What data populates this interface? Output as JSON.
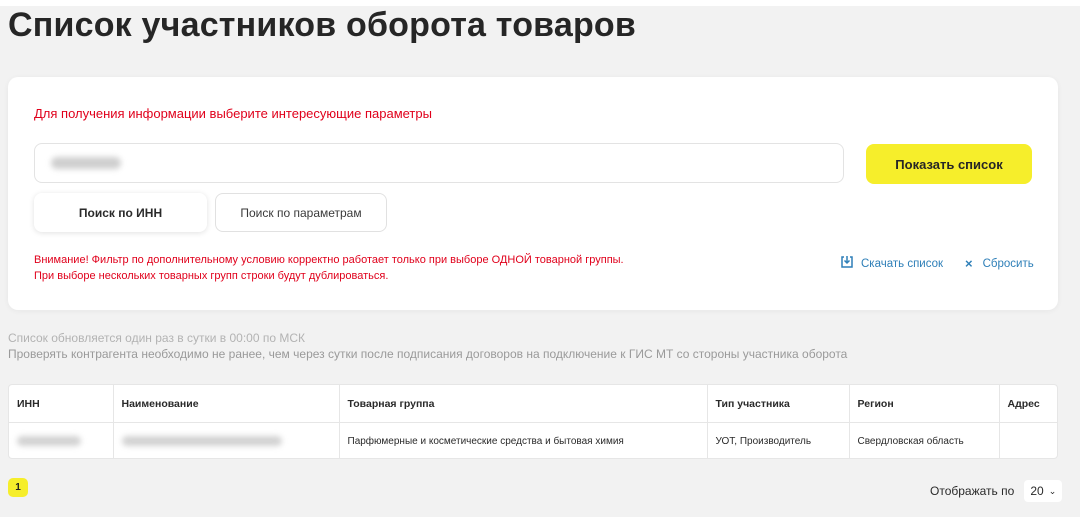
{
  "page": {
    "title": "Список участников оборота товаров"
  },
  "filter": {
    "hint": "Для получения информации выберите интересующие параметры",
    "search_value": "",
    "submit_label": "Показать список",
    "tabs": [
      {
        "label": "Поиск по ИНН",
        "active": true
      },
      {
        "label": "Поиск по параметрам",
        "active": false
      }
    ],
    "warning_line1": "Внимание! Фильтр по дополнительному условию корректно работает только при выборе ОДНОЙ товарной группы.",
    "warning_line2": "При выборе нескольких товарных групп строки будут дублироваться.",
    "download_label": "Скачать список",
    "download_icon": "download-icon",
    "reset_label": "Сбросить",
    "reset_icon": "close-icon"
  },
  "notes": {
    "line1": "Список обновляется один раз в сутки в 00:00 по МСК",
    "line2": "Проверять контрагента необходимо не ранее, чем через сутки после подписания договоров на подключение к ГИС МТ со стороны участника оборота"
  },
  "table": {
    "headers": [
      "ИНН",
      "Наименование",
      "Товарная группа",
      "Тип участника",
      "Регион",
      "Адрес"
    ],
    "rows": [
      {
        "inn": "",
        "name": "",
        "group": "Парфюмерные и косметические средства и бытовая химия",
        "type": "УОТ, Производитель",
        "region": "Свердловская область",
        "address": ""
      }
    ]
  },
  "pagination": {
    "current_page": "1",
    "per_page_label": "Отображать по",
    "per_page_value": "20"
  },
  "colors": {
    "accent_yellow": "#f6ee2b",
    "alert_red": "#e0001b",
    "link_blue": "#2e7fb8"
  }
}
